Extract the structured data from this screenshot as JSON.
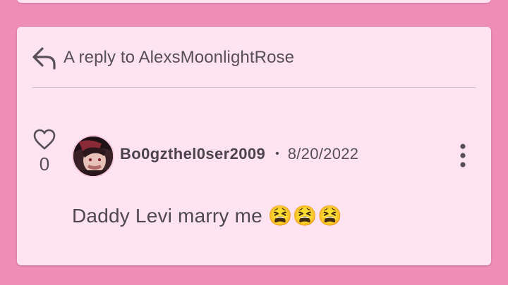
{
  "reply": {
    "prefix": "A reply to AlexsMoonlightRose"
  },
  "comment": {
    "like_count": "0",
    "username": "Bo0gzthel0ser2009",
    "separator": "•",
    "date": "8/20/2022",
    "text": "Daddy Levi marry me 😫😫😫"
  },
  "icons": {
    "reply": "reply-arrow-icon",
    "like": "heart-icon",
    "more": "more-vertical-icon"
  },
  "colors": {
    "page_background": "#ef8db6",
    "card_background": "#ffe3f1",
    "text": "#574e57"
  }
}
